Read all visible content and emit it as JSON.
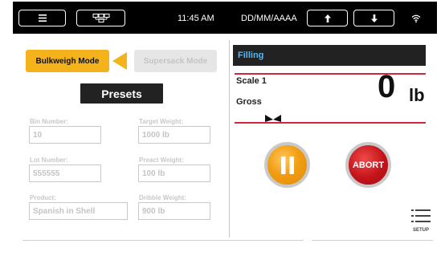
{
  "statusbar": {
    "time": "11:45 AM",
    "date_format": "DD/MM/AAAA",
    "icons": [
      "menu-icon",
      "network-nodes-icon",
      "up-arrow-icon",
      "down-arrow-icon",
      "wifi-icon"
    ]
  },
  "modes": {
    "bulkweigh": "Bulkweigh Mode",
    "supersack": "Supersack Mode",
    "presets": "Presets"
  },
  "fields": {
    "bin_number": {
      "label": "Bin Number:",
      "value": "10"
    },
    "target_weight": {
      "label": "Target Weight:",
      "value": "1000 lb"
    },
    "lot_number": {
      "label": "Lot Number:",
      "value": "555555"
    },
    "preact_weight": {
      "label": "Preact Weight:",
      "value": "100 lb"
    },
    "product": {
      "label": "Product:",
      "value": "Spanish in Shell"
    },
    "dribble_weight": {
      "label": "Dribble Weight:",
      "value": "900 lb"
    }
  },
  "status": {
    "state": "Filling",
    "scale": "Scale 1",
    "mode": "Gross",
    "weight": "0",
    "unit": "lb"
  },
  "actions": {
    "abort": "ABORT",
    "setup": "SETUP"
  },
  "colors": {
    "accent": "#f5b31b",
    "status_text": "#57b8f0",
    "divider_red": "#cc2a3a",
    "abort": "#c3141a"
  }
}
